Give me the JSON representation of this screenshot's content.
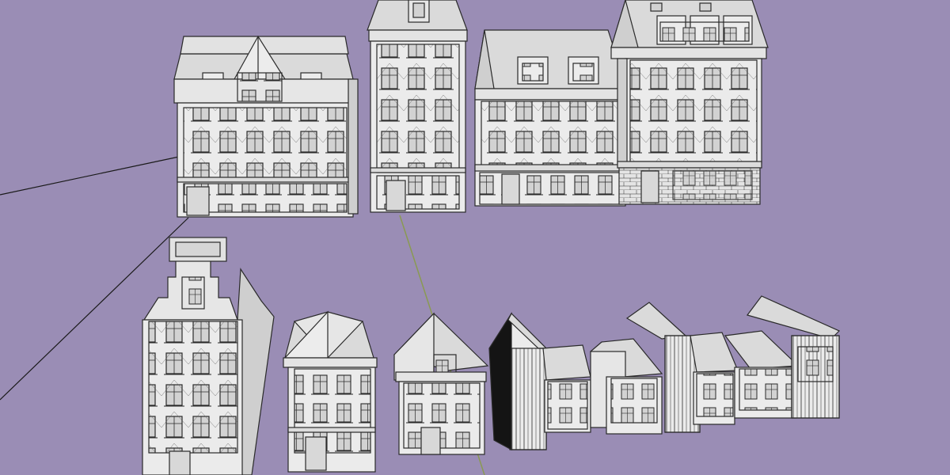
{
  "viewport": {
    "background_color": "#9A8DB5",
    "model_face_color": "#EBEBEB",
    "model_shade_color": "#CFCFCF",
    "model_roof_color": "#DADADA",
    "window_color": "#D6D6D6",
    "outline_color": "#2A2A2A",
    "axis_green_color": "#8A9A52",
    "axis_black_color": "#1A1A1A"
  },
  "scene": {
    "model_count": 10,
    "rows": 2
  }
}
